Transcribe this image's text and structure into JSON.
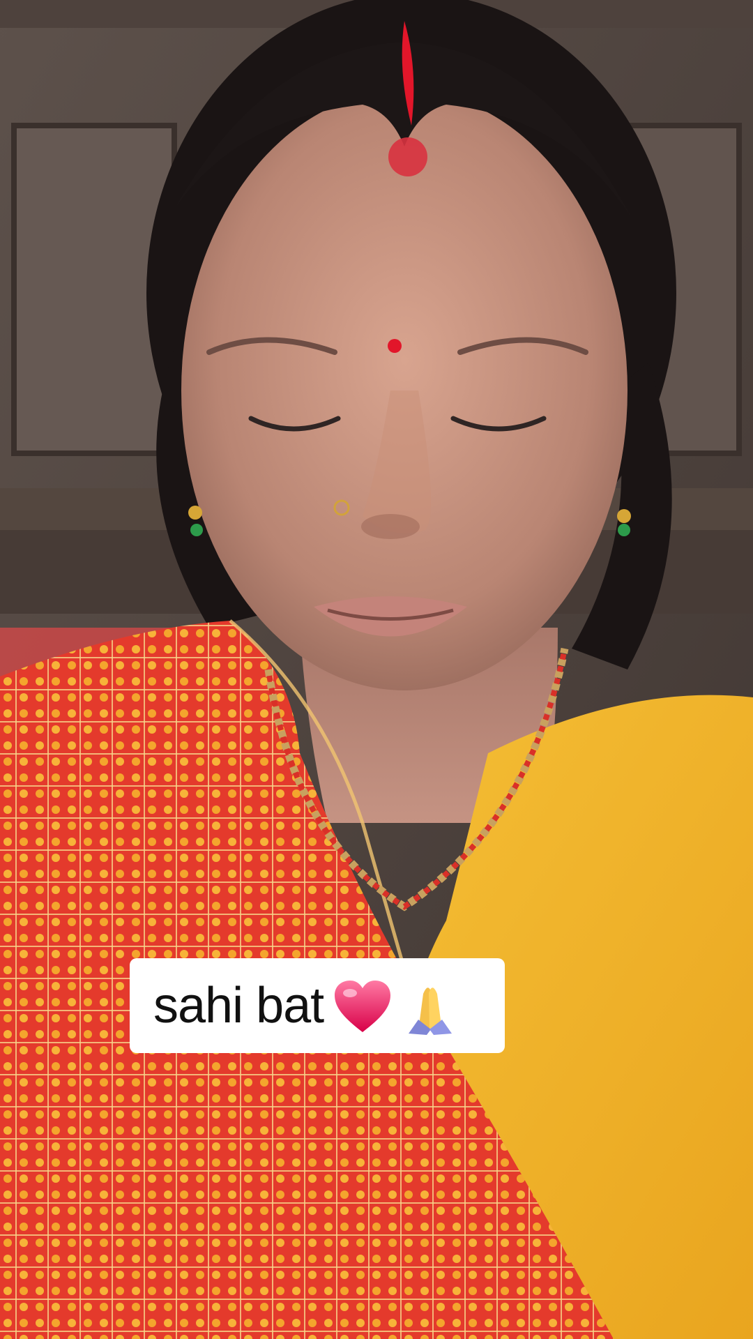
{
  "caption": {
    "text": "sahi bat",
    "emojis": [
      "heart-icon",
      "folded-hands-icon"
    ]
  },
  "colors": {
    "caption_background": "#ffffff",
    "caption_text": "#111111",
    "blouse": "#f2b22a",
    "dupatta": "#e6352b",
    "sindoor": "#e2162a"
  }
}
